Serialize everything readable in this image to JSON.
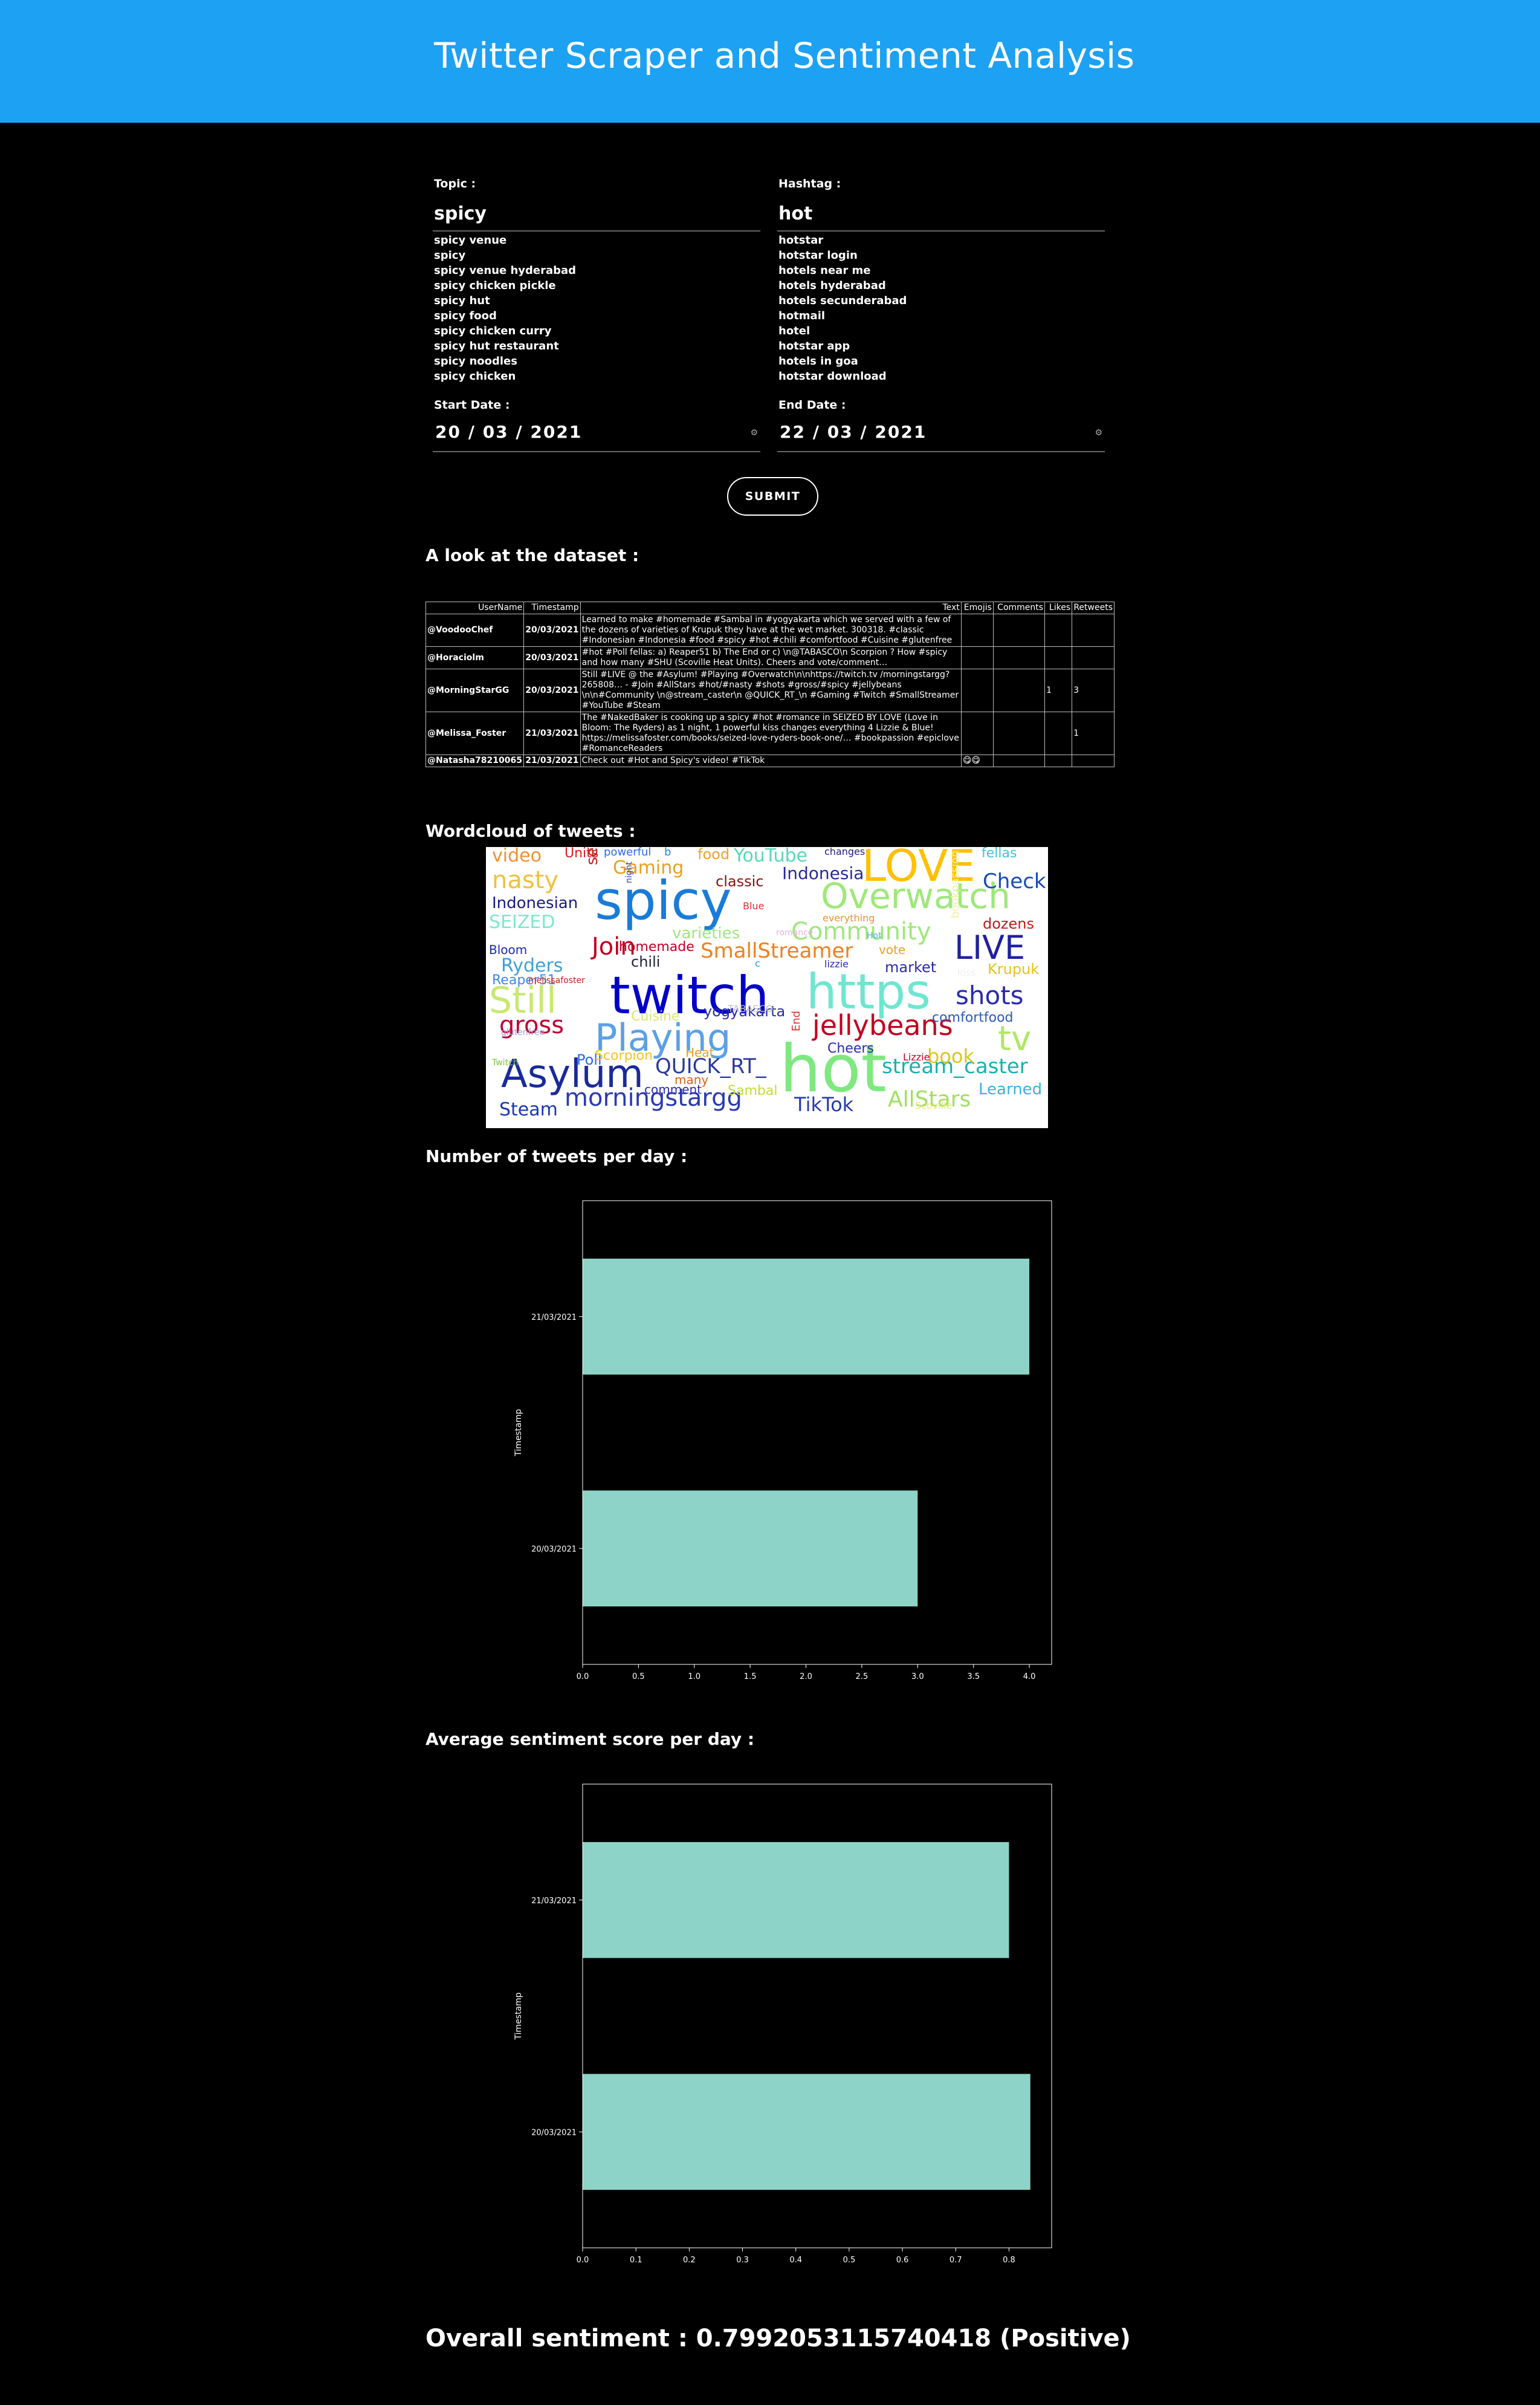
{
  "header": {
    "title": "Twitter Scraper and Sentiment Analysis"
  },
  "form": {
    "topic_label": "Topic :",
    "topic_value": "spicy",
    "topic_suggestions": [
      "spicy venue",
      "spicy",
      "spicy venue hyderabad",
      "spicy chicken pickle",
      "spicy hut",
      "spicy food",
      "spicy chicken curry",
      "spicy hut restaurant",
      "spicy noodles",
      "spicy chicken"
    ],
    "hashtag_label": "Hashtag :",
    "hashtag_value": "hot",
    "hashtag_suggestions": [
      "hotstar",
      "hotstar login",
      "hotels near me",
      "hotels hyderabad",
      "hotels secunderabad",
      "hotmail",
      "hotel",
      "hotstar app",
      "hotels in goa",
      "hotstar download"
    ],
    "start_label": "Start Date :",
    "start_value": "20 / 03 / 2021",
    "end_label": "End Date :",
    "end_value": "22 / 03 / 2021",
    "submit_label": "SUBMIT"
  },
  "dataset": {
    "title": "A look at the dataset :",
    "columns": [
      "UserName",
      "Timestamp",
      "Text",
      "Emojis",
      "Comments",
      "Likes",
      "Retweets"
    ],
    "rows": [
      {
        "user": "@VoodooChef",
        "ts": "20/03/2021",
        "text": "Learned to make #homemade #Sambal in #yogyakarta which we served with a few of the dozens of varieties of Krupuk they have at the wet market. 300318. #classic #Indonesian #Indonesia #food #spicy #hot #chili #comfortfood #Cuisine #glutenfree",
        "emojis": "",
        "comments": "",
        "likes": "",
        "retweets": ""
      },
      {
        "user": "@Horaciolm",
        "ts": "20/03/2021",
        "text": "#hot #Poll fellas: a) Reaper51 b) The End or c) \\n@TABASCO\\n Scorpion ? How #spicy and how many #SHU (Scoville Heat Units). Cheers and vote/comment…",
        "emojis": "",
        "comments": "",
        "likes": "",
        "retweets": ""
      },
      {
        "user": "@MorningStarGG",
        "ts": "20/03/2021",
        "text": "Still #LIVE @ the #Asylum! #Playing #Overwatch\\n\\nhttps://twitch.tv /morningstargg?265808… - #Join #AllStars #hot/#nasty #shots #gross/#spicy #jellybeans \\n\\n#Community \\n@stream_caster\\n @QUICK_RT_\\n #Gaming #Twitch #SmallStreamer #YouTube #Steam",
        "emojis": "",
        "comments": "",
        "likes": "1",
        "retweets": "3"
      },
      {
        "user": "@Melissa_Foster",
        "ts": "21/03/2021",
        "text": "The #NakedBaker is cooking up a spicy #hot #romance in SEIZED BY LOVE (Love in Bloom: The Ryders) as 1 night, 1 powerful kiss changes everything 4 Lizzie & Blue! https://melissafoster.com/books/seized-love-ryders-book-one/… #bookpassion #epiclove #RomanceReaders",
        "emojis": "",
        "comments": "",
        "likes": "",
        "retweets": "1"
      },
      {
        "user": "@Natasha78210065",
        "ts": "21/03/2021",
        "text": "Check out #Hot and Spicy's video! #TikTok",
        "emojis": "😋😋",
        "comments": "",
        "likes": "",
        "retweets": ""
      }
    ]
  },
  "wordcloud": {
    "title": "Wordcloud of tweets :",
    "words": [
      "spicy",
      "twitch",
      "hot",
      "https",
      "Playing",
      "Asylum",
      "LOVE",
      "Overwatch",
      "LIVE",
      "Still",
      "jellybeans",
      "morningstargg",
      "tv",
      "Community",
      "shots",
      "nasty",
      "gross",
      "Join",
      "SmallStreamer",
      "AllStars",
      "stream_caster",
      "QUICK_RT_",
      "Check",
      "Gaming",
      "YouTube",
      "Indonesian",
      "Indonesia",
      "SEIZED",
      "Ryders",
      "TikTok",
      "Steam",
      "classic",
      "video",
      "food",
      "Units",
      "homemade",
      "chili",
      "dozens",
      "market",
      "comfortfood",
      "book",
      "varieties",
      "yogyakarta",
      "Cheers",
      "Learned",
      "Krupuk",
      "fellas",
      "served",
      "comment",
      "Reaper51",
      "Bloom",
      "Poll",
      "Cuisine",
      "Scorpion",
      "Sambal",
      "Heat",
      "many",
      "End",
      "Blue",
      "powerful",
      "changes",
      "everything",
      "Scoville",
      "melissafoster",
      "night",
      "bookpassion",
      "lizzie",
      "vote",
      "kiss",
      "TABASCO",
      "glutenfree",
      "romance",
      "Lizzie",
      "b",
      "c",
      "Hot",
      "Twitch",
      "RomanceReaders"
    ]
  },
  "tweets_chart": {
    "title": "Number of tweets per day :",
    "chart_data": {
      "type": "bar",
      "orientation": "horizontal",
      "categories": [
        "21/03/2021",
        "20/03/2021"
      ],
      "values": [
        4,
        3
      ],
      "ylabel": "Timestamp",
      "xticks": [
        "0.0",
        "0.5",
        "1.0",
        "1.5",
        "2.0",
        "2.5",
        "3.0",
        "3.5",
        "4.0"
      ],
      "xlim": [
        0,
        4.2
      ],
      "bar_color": "#8dd3c7"
    }
  },
  "sentiment_chart": {
    "title": "Average sentiment score per day :",
    "chart_data": {
      "type": "bar",
      "orientation": "horizontal",
      "categories": [
        "21/03/2021",
        "20/03/2021"
      ],
      "values": [
        0.8,
        0.84
      ],
      "ylabel": "Timestamp",
      "xticks": [
        "0.0",
        "0.1",
        "0.2",
        "0.3",
        "0.4",
        "0.5",
        "0.6",
        "0.7",
        "0.8"
      ],
      "xlim": [
        0,
        0.88
      ],
      "bar_color": "#8dd3c7"
    }
  },
  "overall": {
    "text": "Overall sentiment : 0.7992053115740418 (Positive)"
  }
}
